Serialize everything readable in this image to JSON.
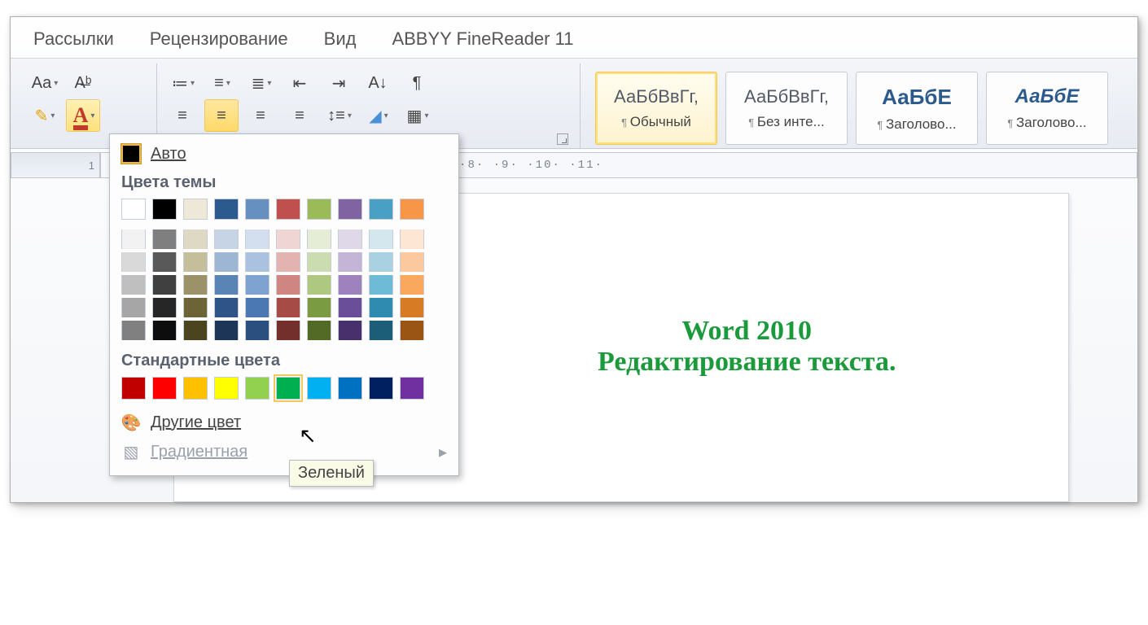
{
  "tabs": {
    "mailings": "Рассылки",
    "review": "Рецензирование",
    "view": "Вид",
    "abbyy": "ABBYY FineReader 11"
  },
  "font": {
    "changeCase": "Aa",
    "fontColorLetter": "A"
  },
  "styles": {
    "normal": {
      "sample": "АаБбВвГг,",
      "label": "Обычный"
    },
    "nospace": {
      "sample": "АаБбВвГг,",
      "label": "Без инте..."
    },
    "heading1": {
      "sample": "АаБбЕ",
      "label": "Заголово..."
    },
    "heading2": {
      "sample": "АаБбЕ",
      "label": "Заголово..."
    }
  },
  "ruler": {
    "left": "1",
    "ticks": "·2· ·1· · · ·1· ·2· ·3· ·4· ·5· ·6· ·7· ·8· ·9· ·10· ·11·"
  },
  "dropdown": {
    "auto": "Авто",
    "themeHeader": "Цвета темы",
    "stdHeader": "Стандартные цвета",
    "more": "Другие цвет",
    "gradient": "Градиентная",
    "tooltip": "Зеленый",
    "themeRow": [
      "#ffffff",
      "#000000",
      "#eee8d9",
      "#2d5a8e",
      "#6590bf",
      "#c0504d",
      "#9bbb59",
      "#8064a2",
      "#48a1c5",
      "#f79646"
    ],
    "shades": [
      [
        "#f2f2f2",
        "#7f7f7f",
        "#ddd9c4",
        "#c6d4e6",
        "#d3dfef",
        "#efd6d4",
        "#e5edd7",
        "#dfd8e8",
        "#d4e7ef",
        "#fde6d4"
      ],
      [
        "#d9d9d9",
        "#595959",
        "#c5be9b",
        "#9db6d4",
        "#aac2e0",
        "#e2b3b0",
        "#cbddb0",
        "#c4b5d6",
        "#aad1e2",
        "#fbc99d"
      ],
      [
        "#bfbfbf",
        "#404040",
        "#9b926a",
        "#5a84b5",
        "#7ea3d0",
        "#cf8581",
        "#aec97f",
        "#9d82bd",
        "#6dbbd6",
        "#f9a85e"
      ],
      [
        "#a6a6a6",
        "#262626",
        "#6c6437",
        "#2f5487",
        "#4b78b2",
        "#a64b46",
        "#7b9b43",
        "#6b4e9a",
        "#2f8bb0",
        "#d77c24"
      ],
      [
        "#808080",
        "#0d0d0d",
        "#4a441f",
        "#1d3556",
        "#2b4f7f",
        "#722f2b",
        "#536a26",
        "#48306c",
        "#1c5e78",
        "#9a5414"
      ]
    ],
    "standard": [
      "#c00000",
      "#ff0000",
      "#ffc000",
      "#ffff00",
      "#92d050",
      "#00b050",
      "#00b0f0",
      "#0070c0",
      "#002060",
      "#7030a0"
    ],
    "selectedStandardIndex": 5
  },
  "document": {
    "line1": "Word  2010",
    "line2": "Редактирование текста."
  }
}
